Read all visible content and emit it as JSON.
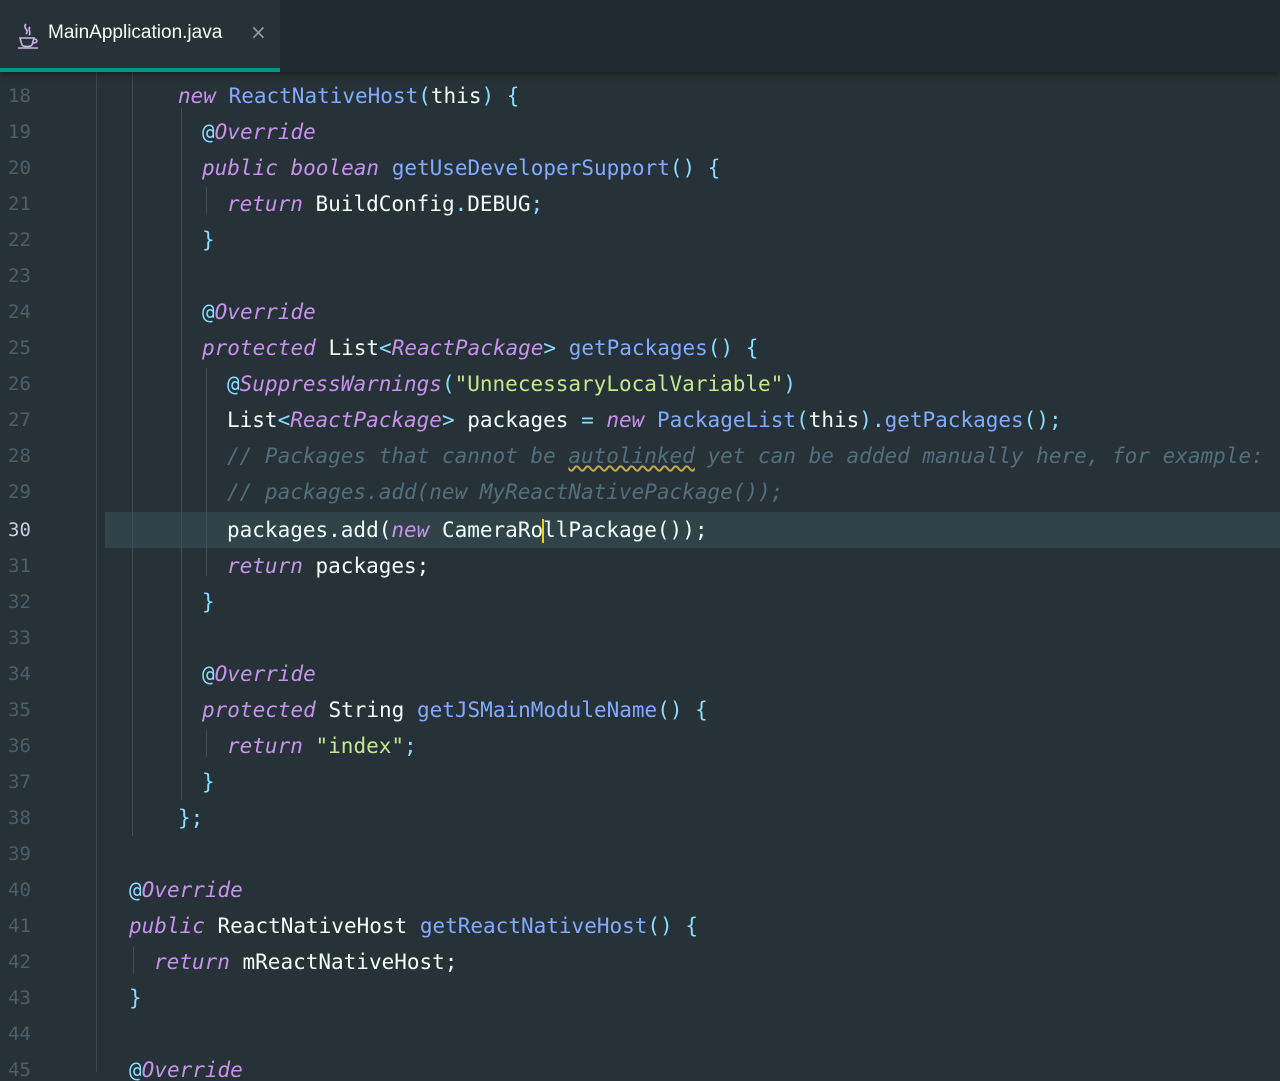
{
  "tab": {
    "filename": "MainApplication.java",
    "close": "×",
    "icon": "java-icon"
  },
  "colors": {
    "accent": "#009688",
    "caret": "#ffcc00",
    "background": "#263238"
  },
  "editor": {
    "current_line": 30,
    "lines": [
      {
        "n": "18",
        "t": {
          "a": "new",
          "b": "ReactNativeHost",
          "c": "(",
          "d": "this",
          "e": ")",
          "f": "{"
        }
      },
      {
        "n": "19",
        "t": {
          "a": "@",
          "b": "Override"
        }
      },
      {
        "n": "20",
        "t": {
          "a": "public",
          "b": "boolean",
          "c": "getUseDeveloperSupport",
          "d": "()",
          "e": "{"
        }
      },
      {
        "n": "21",
        "t": {
          "a": "return",
          "b": "BuildConfig",
          "c": ".",
          "d": "DEBUG",
          "e": ";"
        }
      },
      {
        "n": "22",
        "t": {
          "a": "}"
        }
      },
      {
        "n": "23",
        "t": {}
      },
      {
        "n": "24",
        "t": {
          "a": "@",
          "b": "Override"
        }
      },
      {
        "n": "25",
        "t": {
          "a": "protected",
          "b": "List",
          "c": "<",
          "d": "ReactPackage",
          "e": ">",
          "f": "getPackages",
          "g": "()",
          "h": "{"
        }
      },
      {
        "n": "26",
        "t": {
          "a": "@",
          "b": "SuppressWarnings",
          "c": "(",
          "d": "\"UnnecessaryLocalVariable\"",
          "e": ")"
        }
      },
      {
        "n": "27",
        "t": {
          "a": "List",
          "b": "<",
          "c": "ReactPackage",
          "d": ">",
          "e": "packages",
          "f": "=",
          "g": "new",
          "h": "PackageList",
          "i": "(",
          "j": "this",
          "k": ").",
          "l": "getPackages",
          "m": "();"
        }
      },
      {
        "n": "28",
        "t": {
          "a": "// Packages that cannot be ",
          "b": "autolinked",
          "c": " yet can be added manually here, for example:"
        }
      },
      {
        "n": "29",
        "t": {
          "a": "// packages.add(new MyReactNativePackage());"
        }
      },
      {
        "n": "30",
        "t": {
          "a": "packages.add(",
          "b": "new",
          "c": "CameraRo",
          "d": "llPackage());"
        }
      },
      {
        "n": "31",
        "t": {
          "a": "return",
          "b": "packages;"
        }
      },
      {
        "n": "32",
        "t": {
          "a": "}"
        }
      },
      {
        "n": "33",
        "t": {}
      },
      {
        "n": "34",
        "t": {
          "a": "@",
          "b": "Override"
        }
      },
      {
        "n": "35",
        "t": {
          "a": "protected",
          "b": "String",
          "c": "getJSMainModuleName",
          "d": "()",
          "e": "{"
        }
      },
      {
        "n": "36",
        "t": {
          "a": "return",
          "b": "\"index\"",
          "c": ";"
        }
      },
      {
        "n": "37",
        "t": {
          "a": "}"
        }
      },
      {
        "n": "38",
        "t": {
          "a": "};"
        }
      },
      {
        "n": "39",
        "t": {}
      },
      {
        "n": "40",
        "t": {
          "a": "@",
          "b": "Override"
        }
      },
      {
        "n": "41",
        "t": {
          "a": "public",
          "b": "ReactNativeHost",
          "c": "getReactNativeHost",
          "d": "()",
          "e": "{"
        }
      },
      {
        "n": "42",
        "t": {
          "a": "return",
          "b": "mReactNativeHost;"
        }
      },
      {
        "n": "43",
        "t": {
          "a": "}"
        }
      },
      {
        "n": "44",
        "t": {}
      },
      {
        "n": "45",
        "t": {
          "a": "@",
          "b": "Override"
        }
      }
    ]
  }
}
